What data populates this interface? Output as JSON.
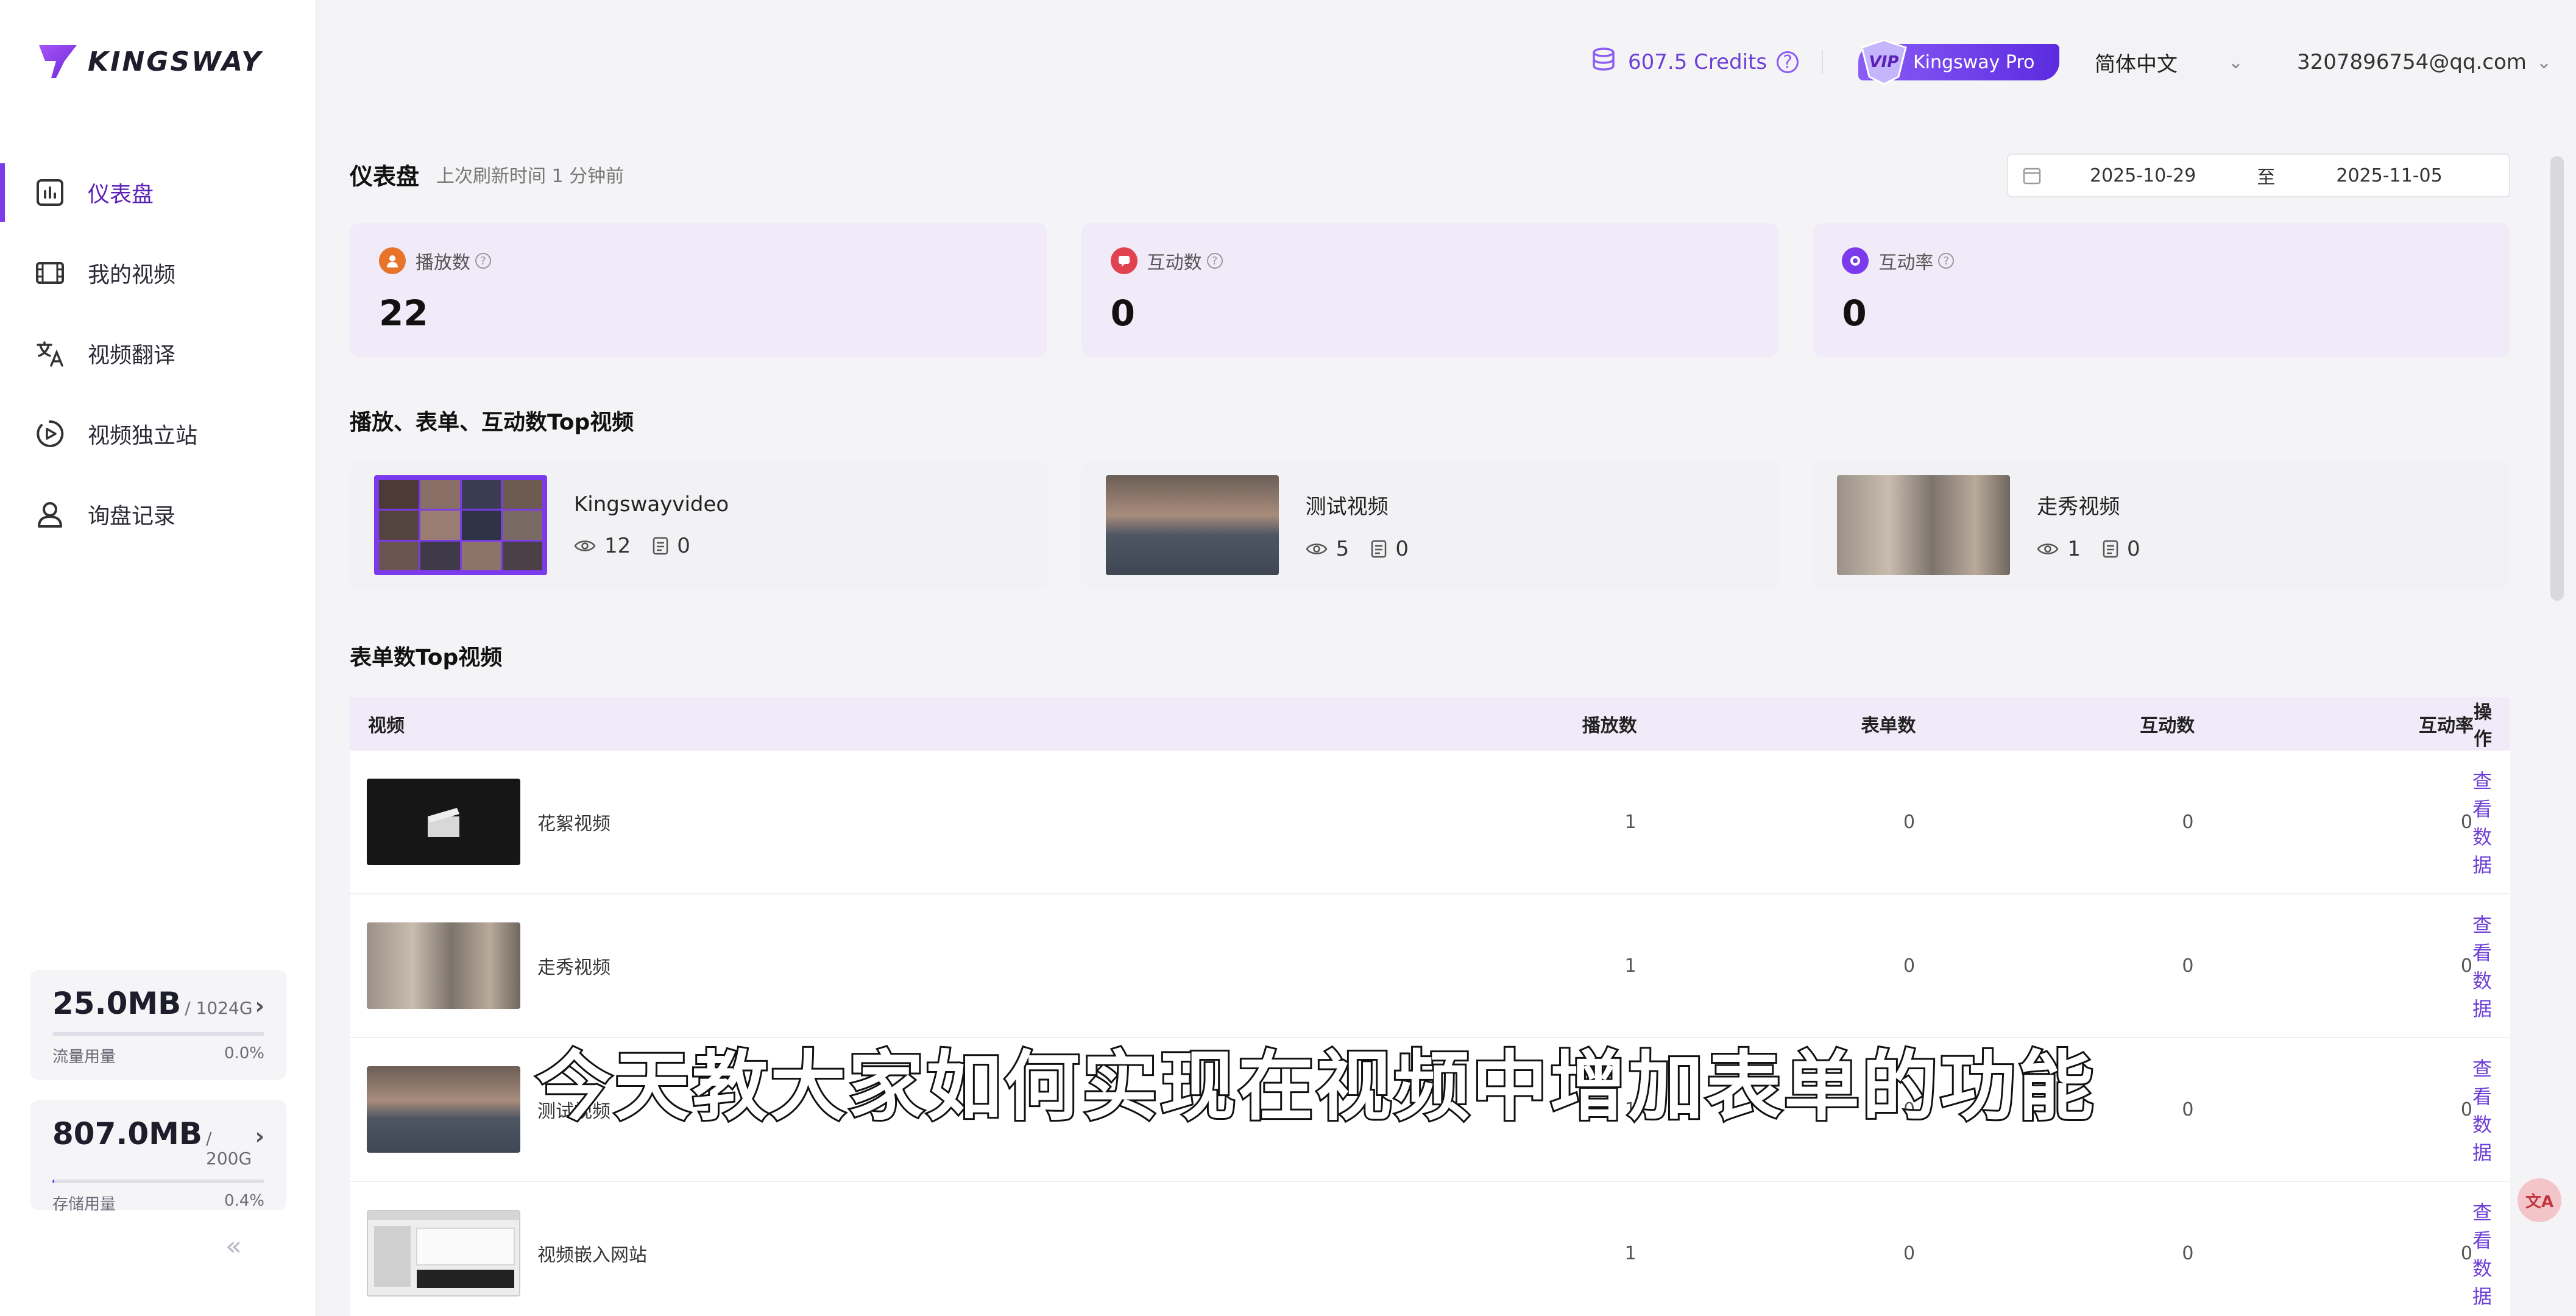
{
  "brand": {
    "name": "KINGSWAY"
  },
  "header": {
    "credits": "607.5 Credits",
    "vip_badge": "VIP",
    "pro_label": "Kingsway Pro",
    "language": "简体中文",
    "user_email": "3207896754@qq.com"
  },
  "sidebar": {
    "items": [
      {
        "label": "仪表盘",
        "icon": "dashboard-icon",
        "active": true
      },
      {
        "label": "我的视频",
        "icon": "film-icon",
        "active": false
      },
      {
        "label": "视频翻译",
        "icon": "translate-icon",
        "active": false
      },
      {
        "label": "视频独立站",
        "icon": "play-site-icon",
        "active": false
      },
      {
        "label": "询盘记录",
        "icon": "contact-icon",
        "active": false
      }
    ],
    "traffic": {
      "value": "25.0MB",
      "quota": "/ 1024G",
      "label": "流量用量",
      "percent": "0.0%",
      "fraction": 0.0
    },
    "storage": {
      "value": "807.0MB",
      "quota": "/ 200G",
      "label": "存储用量",
      "percent": "0.4%",
      "fraction": 0.004
    }
  },
  "dashboard": {
    "title": "仪表盘",
    "refresh": "上次刷新时间 1 分钟前",
    "date_from": "2025-10-29",
    "date_sep": "至",
    "date_to": "2025-11-05"
  },
  "stats": [
    {
      "label": "播放数",
      "value": "22",
      "color": "#e8732a"
    },
    {
      "label": "互动数",
      "value": "0",
      "color": "#e0434f"
    },
    {
      "label": "互动率",
      "value": "0",
      "color": "#7c3aed"
    }
  ],
  "top_section": {
    "title": "播放、表单、互动数Top视频",
    "videos": [
      {
        "name": "Kingswayvideo",
        "views": "12",
        "forms": "0"
      },
      {
        "name": "测试视频",
        "views": "5",
        "forms": "0"
      },
      {
        "name": "走秀视频",
        "views": "1",
        "forms": "0"
      }
    ]
  },
  "form_section": {
    "title": "表单数Top视频",
    "columns": [
      "视频",
      "播放数",
      "表单数",
      "互动数",
      "互动率",
      "操作"
    ],
    "rows": [
      {
        "name": "花絮视频",
        "plays": "1",
        "forms": "0",
        "interactions": "0",
        "rate": "0",
        "action": "查看数据"
      },
      {
        "name": "走秀视频",
        "plays": "1",
        "forms": "0",
        "interactions": "0",
        "rate": "0",
        "action": "查看数据"
      },
      {
        "name": "测试视频",
        "plays": "1",
        "forms": "0",
        "interactions": "0",
        "rate": "0",
        "action": "查看数据"
      },
      {
        "name": "视频嵌入网站",
        "plays": "1",
        "forms": "0",
        "interactions": "0",
        "rate": "0",
        "action": "查看数据"
      }
    ]
  },
  "subtitle": "今天教大家如何实现在视频中增加表单的功能",
  "float_button": "文A",
  "accent_color": "#7c3aed"
}
